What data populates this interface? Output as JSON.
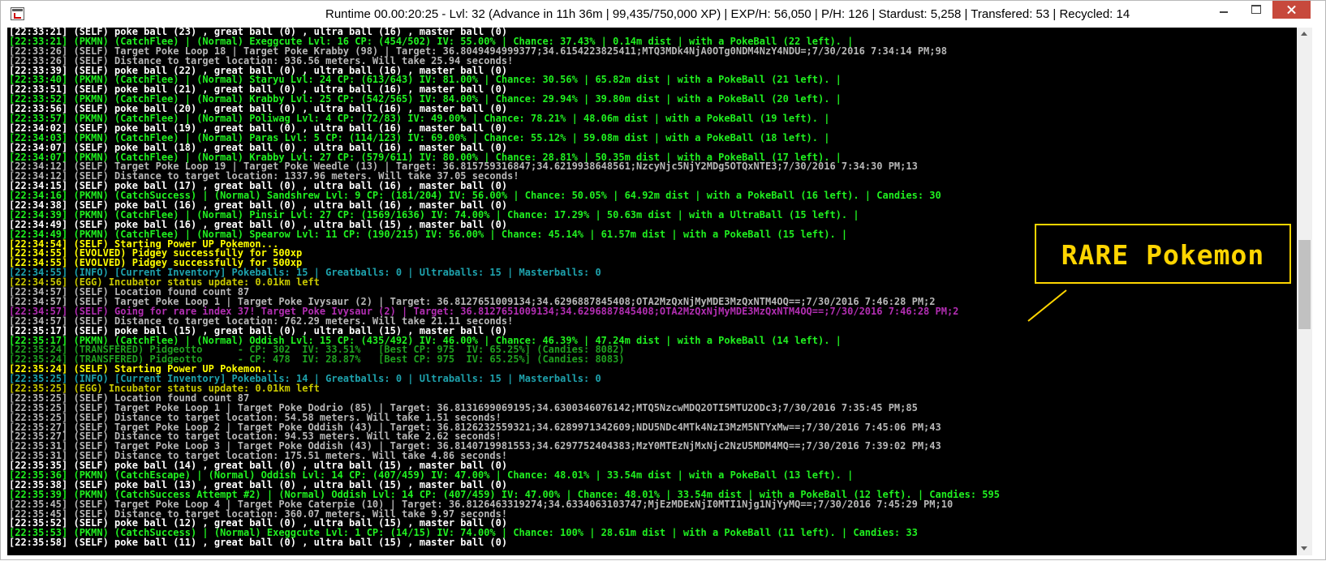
{
  "window": {
    "title": "Runtime 00.00:20:25 - Lvl: 32 (Advance in 11h 36m | 99,435/750,000 XP) | EXP/H: 56,050 | P/H: 126 | Stardust: 5,258 | Transfered: 53 | Recycled: 14",
    "icon": "console-app-icon",
    "controls": [
      "minimize",
      "maximize",
      "close"
    ]
  },
  "colors": {
    "self": "#ffffff",
    "pkmn": "#20f020",
    "info_gray": "#b7b7b7",
    "evolved": "#ffff00",
    "info_cyan": "#1ea2ad",
    "egg": "#c8c800",
    "rare": "#b22eb2",
    "transfered": "#1fa01f",
    "callout": "#ffd500",
    "close_button": "#c7493c"
  },
  "callout": {
    "label": "RARE Pokemon"
  },
  "console": {
    "lines": [
      {
        "c": "white",
        "t": "[22:33:21] (SELF) poke ball (23) , great ball (0) , ultra ball (16) , master ball (0)"
      },
      {
        "c": "green",
        "t": "[22:33:21] (PKMN) (CatchFlee) | (Normal) Exeggcute Lvl: 16 CP: (454/502) IV: 55.00% | Chance: 37.43% | 0.14m dist | with a PokeBall (22 left). |"
      },
      {
        "c": "gray",
        "t": "[22:33:26] (SELF) Target Poke Loop 18 | Target Poke Krabby (98) | Target: 36.8049494999377;34.6154223825411;MTQ3MDk4NjA0OTg0NDM4NzY4NDU=;7/30/2016 7:34:14 PM;98"
      },
      {
        "c": "gray",
        "t": "[22:33:26] (SELF) Distance to target location: 936.56 meters. Will take 25.94 seconds!"
      },
      {
        "c": "white",
        "t": "[22:33:39] (SELF) poke ball (22) , great ball (0) , ultra ball (16) , master ball (0)"
      },
      {
        "c": "green",
        "t": "[22:33:40] (PKMN) (CatchFlee) | (Normal) Staryu Lvl: 24 CP: (613/643) IV: 81.00% | Chance: 30.56% | 65.82m dist | with a PokeBall (21 left). |"
      },
      {
        "c": "white",
        "t": "[22:33:51] (SELF) poke ball (21) , great ball (0) , ultra ball (16) , master ball (0)"
      },
      {
        "c": "green",
        "t": "[22:33:52] (PKMN) (CatchFlee) | (Normal) Krabby Lvl: 25 CP: (542/565) IV: 84.00% | Chance: 29.94% | 39.80m dist | with a PokeBall (20 left). |"
      },
      {
        "c": "white",
        "t": "[22:33:56] (SELF) poke ball (20) , great ball (0) , ultra ball (16) , master ball (0)"
      },
      {
        "c": "green",
        "t": "[22:33:57] (PKMN) (CatchFlee) | (Normal) Poliwag Lvl: 4 CP: (72/83) IV: 49.00% | Chance: 78.21% | 48.06m dist | with a PokeBall (19 left). |"
      },
      {
        "c": "white",
        "t": "[22:34:02] (SELF) poke ball (19) , great ball (0) , ultra ball (16) , master ball (0)"
      },
      {
        "c": "green",
        "t": "[22:34:03] (PKMN) (CatchFlee) | (Normal) Paras Lvl: 5 CP: (114/123) IV: 69.00% | Chance: 55.12% | 59.08m dist | with a PokeBall (18 left). |"
      },
      {
        "c": "white",
        "t": "[22:34:07] (SELF) poke ball (18) , great ball (0) , ultra ball (16) , master ball (0)"
      },
      {
        "c": "green",
        "t": "[22:34:07] (PKMN) (CatchFlee) | (Normal) Krabby Lvl: 27 CP: (579/611) IV: 80.00% | Chance: 28.81% | 50.35m dist | with a PokeBall (17 left). |"
      },
      {
        "c": "gray",
        "t": "[22:34:12] (SELF) Target Poke Loop 19 | Target Poke Weedle (13) | Target: 36.815759316847;34.6219938648561;NzcyNjc5NjY2MDg5OTQxNTE3;7/30/2016 7:34:30 PM;13"
      },
      {
        "c": "gray",
        "t": "[22:34:12] (SELF) Distance to target location: 1337.96 meters. Will take 37.05 seconds!"
      },
      {
        "c": "white",
        "t": "[22:34:15] (SELF) poke ball (17) , great ball (0) , ultra ball (16) , master ball (0)"
      },
      {
        "c": "green",
        "t": "[22:34:16] (PKMN) (CatchSuccess) | (Normal) Sandshrew Lvl: 9 CP: (181/204) IV: 56.00% | Chance: 50.05% | 64.92m dist | with a PokeBall (16 left). | Candies: 30"
      },
      {
        "c": "white",
        "t": "[22:34:38] (SELF) poke ball (16) , great ball (0) , ultra ball (16) , master ball (0)"
      },
      {
        "c": "green",
        "t": "[22:34:39] (PKMN) (CatchFlee) | (Normal) Pinsir Lvl: 27 CP: (1569/1636) IV: 74.00% | Chance: 17.29% | 50.63m dist | with a UltraBall (15 left). |"
      },
      {
        "c": "white",
        "t": "[22:34:49] (SELF) poke ball (16) , great ball (0) , ultra ball (15) , master ball (0)"
      },
      {
        "c": "green",
        "t": "[22:34:49] (PKMN) (CatchFlee) | (Normal) Spearow Lvl: 11 CP: (190/215) IV: 56.00% | Chance: 45.14% | 61.57m dist | with a PokeBall (15 left). |"
      },
      {
        "c": "yellow",
        "t": "[22:34:54] (SELF) Starting Power UP Pokemon..."
      },
      {
        "c": "yellow",
        "t": "[22:34:55] (EVOLVED) Pidgey successfully for 500xp"
      },
      {
        "c": "yellow",
        "t": "[22:34:55] (EVOLVED) Pidgey successfully for 500xp"
      },
      {
        "c": "cyan",
        "t": "[22:34:55] (INFO) [Current Inventory] Pokeballs: 15 | Greatballs: 0 | Ultraballs: 15 | Masterballs: 0"
      },
      {
        "c": "olive",
        "t": "[22:34:56] (EGG) Incubator status update: 0.01km left"
      },
      {
        "c": "gray",
        "t": "[22:34:57] (SELF) Location found count 87"
      },
      {
        "c": "gray",
        "t": "[22:34:57] (SELF) Target Poke Loop 1 | Target Poke Ivysaur (2) | Target: 36.8127651009134;34.6296887845408;OTA2MzQxNjMyMDE3MzQxNTM4OQ==;7/30/2016 7:46:28 PM;2"
      },
      {
        "c": "magenta",
        "t": "[22:34:57] (SELF) Going for rare index 37! Target Poke Ivysaur (2) | Target: 36.8127651009134;34.6296887845408;OTA2MzQxNjMyMDE3MzQxNTM4OQ==;7/30/2016 7:46:28 PM;2"
      },
      {
        "c": "gray",
        "t": "[22:34:57] (SELF) Distance to target location: 762.29 meters. Will take 21.11 seconds!"
      },
      {
        "c": "white",
        "t": "[22:35:17] (SELF) poke ball (15) , great ball (0) , ultra ball (15) , master ball (0)"
      },
      {
        "c": "green",
        "t": "[22:35:17] (PKMN) (CatchFlee) | (Normal) Oddish Lvl: 15 CP: (435/492) IV: 46.00% | Chance: 46.39% | 47.24m dist | with a PokeBall (14 left). |"
      },
      {
        "c": "dkgreen",
        "t": "[22:35:24] (TRANSFERED) Pidgeotto      - CP: 302  IV: 33.51%   [Best CP: 975  IV: 65.25%] (Candies: 8082)"
      },
      {
        "c": "dkgreen",
        "t": "[22:35:24] (TRANSFERED) Pidgeotto      - CP: 478  IV: 28.87%   [Best CP: 975  IV: 65.25%] (Candies: 8083)"
      },
      {
        "c": "yellow",
        "t": "[22:35:24] (SELF) Starting Power UP Pokemon..."
      },
      {
        "c": "cyan",
        "t": "[22:35:25] (INFO) [Current Inventory] Pokeballs: 14 | Greatballs: 0 | Ultraballs: 15 | Masterballs: 0"
      },
      {
        "c": "olive",
        "t": "[22:35:25] (EGG) Incubator status update: 0.01km left"
      },
      {
        "c": "gray",
        "t": "[22:35:25] (SELF) Location found count 87"
      },
      {
        "c": "gray",
        "t": "[22:35:25] (SELF) Target Poke Loop 1 | Target Poke Dodrio (85) | Target: 36.8131699069195;34.6300346076142;MTQ5NzcwMDQ2OTI5MTU2ODc3;7/30/2016 7:35:45 PM;85"
      },
      {
        "c": "gray",
        "t": "[22:35:25] (SELF) Distance to target location: 54.58 meters. Will take 1.51 seconds!"
      },
      {
        "c": "gray",
        "t": "[22:35:27] (SELF) Target Poke Loop 2 | Target Poke Oddish (43) | Target: 36.8126232559321;34.6289971342609;NDU5NDc4MTk4NzI3MzM5NTYxMw==;7/30/2016 7:45:06 PM;43"
      },
      {
        "c": "gray",
        "t": "[22:35:27] (SELF) Distance to target location: 94.53 meters. Will take 2.62 seconds!"
      },
      {
        "c": "gray",
        "t": "[22:35:31] (SELF) Target Poke Loop 3 | Target Poke Oddish (43) | Target: 36.8140719981553;34.6297752404383;MzY0MTEzNjMxNjc2NzU5MDM4MQ==;7/30/2016 7:39:02 PM;43"
      },
      {
        "c": "gray",
        "t": "[22:35:31] (SELF) Distance to target location: 175.51 meters. Will take 4.86 seconds!"
      },
      {
        "c": "white",
        "t": "[22:35:35] (SELF) poke ball (14) , great ball (0) , ultra ball (15) , master ball (0)"
      },
      {
        "c": "green",
        "t": "[22:35:36] (PKMN) (CatchEscape) | (Normal) Oddish Lvl: 14 CP: (407/459) IV: 47.00% | Chance: 48.01% | 33.54m dist | with a PokeBall (13 left). |"
      },
      {
        "c": "white",
        "t": "[22:35:38] (SELF) poke ball (13) , great ball (0) , ultra ball (15) , master ball (0)"
      },
      {
        "c": "green",
        "t": "[22:35:39] (PKMN) (CatchSuccess Attempt #2) | (Normal) Oddish Lvl: 14 CP: (407/459) IV: 47.00% | Chance: 48.01% | 33.54m dist | with a PokeBall (12 left). | Candies: 595"
      },
      {
        "c": "gray",
        "t": "[22:35:45] (SELF) Target Poke Loop 4 | Target Poke Caterpie (10) | Target: 36.8126463319274;34.6334063103747;MjEzMDExNjI0MTI1Njg1NjYyMQ==;7/30/2016 7:45:29 PM;10"
      },
      {
        "c": "gray",
        "t": "[22:35:45] (SELF) Distance to target location: 360.07 meters. Will take 9.97 seconds!"
      },
      {
        "c": "white",
        "t": "[22:35:52] (SELF) poke ball (12) , great ball (0) , ultra ball (15) , master ball (0)"
      },
      {
        "c": "green",
        "t": "[22:35:53] (PKMN) (CatchSuccess) | (Normal) Exeggcute Lvl: 1 CP: (14/15) IV: 74.00% | Chance: 100% | 28.61m dist | with a PokeBall (11 left). | Candies: 33"
      },
      {
        "c": "white",
        "t": "[22:35:58] (SELF) poke ball (11) , great ball (0) , ultra ball (15) , master ball (0)"
      }
    ]
  }
}
